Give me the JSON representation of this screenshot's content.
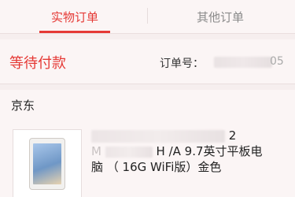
{
  "tabs": [
    {
      "label": "实物订单"
    },
    {
      "label": "其他订单"
    }
  ],
  "order": {
    "status": "等待付款",
    "order_label": "订单号：",
    "order_tail": "05"
  },
  "shop": {
    "name": "京东"
  },
  "product": {
    "line1_tail": "2",
    "line2_faded": "M",
    "line2_rest": "H /A 9.7英寸平板电",
    "line3": "脑 （ 16G WiFi版）金色"
  },
  "colors": {
    "accent": "#e53935",
    "muted": "#8a8a8a"
  }
}
